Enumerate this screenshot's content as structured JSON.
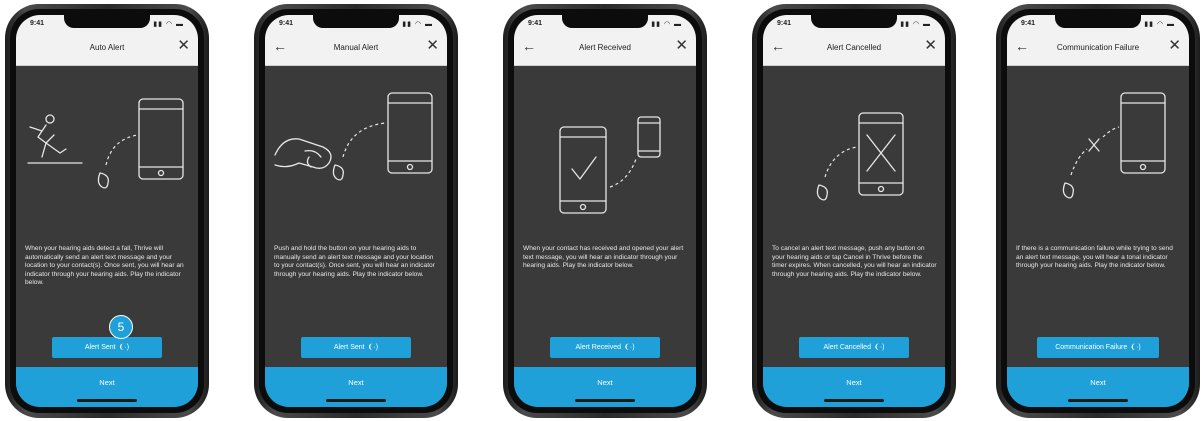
{
  "accent_color": "#1fa0d8",
  "screens": [
    {
      "status_time": "9:41",
      "title": "Auto Alert",
      "description": "When your hearing aids detect a fall, Thrive will automatically send an alert text message and your location to your contact(s). Once sent, you will hear an indicator through your hearing aids. Play the indicator below.",
      "play_button": "Alert Sent",
      "next_label": "Next",
      "step_badge": "5",
      "illustration": "fall-to-phone-icon"
    },
    {
      "status_time": "9:41",
      "title": "Manual Alert",
      "description": "Push and hold the button on your hearing aids to manually send an alert text message and your location to your contact(s). Once sent, you will hear an indicator through your hearing aids. Play the indicator below.",
      "play_button": "Alert Sent",
      "next_label": "Next",
      "illustration": "hand-press-to-phone-icon"
    },
    {
      "status_time": "9:41",
      "title": "Alert Received",
      "description": "When your contact has received and opened your alert text message, you will hear an indicator through your hearing aids. Play the indicator below.",
      "play_button": "Alert Received",
      "next_label": "Next",
      "illustration": "phone-check-icon"
    },
    {
      "status_time": "9:41",
      "title": "Alert Cancelled",
      "description": "To cancel an alert text message, push any button on your hearing aids or tap Cancel in Thrive before the timer expires. When cancelled, you will hear an indicator through your hearing aids. Play the indicator below.",
      "play_button": "Alert Cancelled",
      "next_label": "Next",
      "illustration": "phone-cancel-icon"
    },
    {
      "status_time": "9:41",
      "title": "Communication Failure",
      "description": "If there is a communication failure while trying to send an alert text message, you will hear a tonal indicator through your hearing aids. Play the indicator below.",
      "play_button": "Communication Failure",
      "next_label": "Next",
      "illustration": "communication-failure-icon"
    }
  ]
}
